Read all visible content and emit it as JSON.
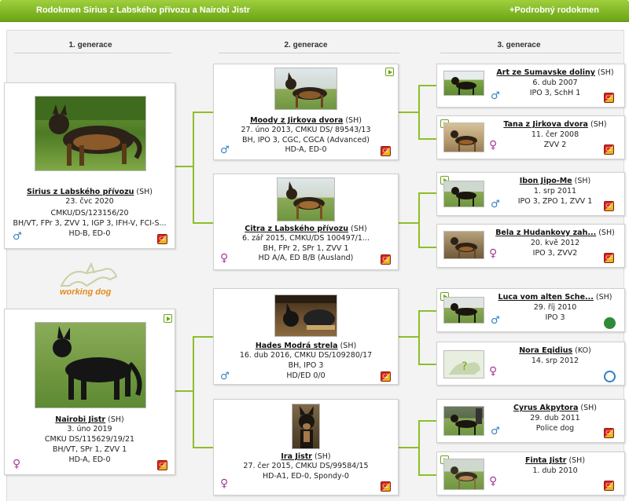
{
  "header": {
    "title": "Rodokmen Sirius z Labského přívozu a Nairobi Jistr",
    "more_link": "+Podrobný rodokmen"
  },
  "generations": [
    "1. generace",
    "2. generace",
    "3. generace"
  ],
  "logo": {
    "word1": "working",
    "word2": "dog"
  },
  "gen1": [
    {
      "name": "Sirius z Labského přívozu",
      "breed": "(SH)",
      "line1": "23. čvc 2020",
      "line2": "CMKU/DS/123156/20",
      "line3": "BH/VT, FPr 3, ZVV 1, IGP 3, IFH-V, FCI-S...",
      "line4": "HD-B, ED-0",
      "sex": "male"
    },
    {
      "name": "Nairobi Jistr",
      "breed": "(SH)",
      "line1": "3. úno 2019",
      "line2": "CMKU DS/115629/19/21",
      "line3": "BH/VT, SPr 1, ZVV 1",
      "line4": "HD-A, ED-0",
      "sex": "female"
    }
  ],
  "gen2": [
    {
      "name": "Moody z Jirkova dvora",
      "breed": "(SH)",
      "line1": "27. úno 2013, CMKU DS/ 89543/13",
      "line2": "BH, IPO 3, CGC, CGCA (Advanced)",
      "line3": "HD-A, ED-0",
      "sex": "male"
    },
    {
      "name": "Citra z Labského přívozu",
      "breed": "(SH)",
      "line1": "6. zář 2015, CMKU/DS 100497/1...",
      "line2": "BH, FPr 2, SPr 1, ZVV 1",
      "line3": "HD A/A, ED B/B (Ausland)",
      "sex": "female"
    },
    {
      "name": "Hades Modrá strela",
      "breed": "(SH)",
      "line1": "16. dub 2016, CMKU DS/109280/17",
      "line2": "BH, IPO 3",
      "line3": "HD/ED 0/0",
      "sex": "male"
    },
    {
      "name": "Ira Jistr",
      "breed": "(SH)",
      "line1": "27. čer 2015, CMKU DS/99584/15",
      "line2": "HD-A1, ED-0, Spondy-0",
      "line3": "",
      "sex": "female"
    }
  ],
  "gen3": [
    {
      "name": "Art ze Sumavske doliny",
      "breed": "(SH)",
      "line1": "6. dub 2007",
      "line2": "IPO 3, SchH 1",
      "sex": "male"
    },
    {
      "name": "Tana z Jirkova dvora",
      "breed": "(SH)",
      "line1": "11. čer 2008",
      "line2": "ZVV 2",
      "sex": "female"
    },
    {
      "name": "Ibon Jipo-Me",
      "breed": "(SH)",
      "line1": "1. srp 2011",
      "line2": "IPO 3, ZPO 1, ZVV 1",
      "sex": "male"
    },
    {
      "name": "Bela z Hudankovy zah...",
      "breed": "(SH)",
      "line1": "20. kvě 2012",
      "line2": "IPO 3, ZVV2",
      "sex": "female"
    },
    {
      "name": "Luca vom alten Sche...",
      "breed": "(SH)",
      "line1": "29. říj 2010",
      "line2": "IPO 3",
      "sex": "male"
    },
    {
      "name": "Nora Eqidius",
      "breed": "(KO)",
      "line1": "14. srp 2012",
      "line2": "",
      "sex": "female"
    },
    {
      "name": "Cyrus Akpytora",
      "breed": "(SH)",
      "line1": "29. dub 2011",
      "line2": "Police dog",
      "sex": "male"
    },
    {
      "name": "Finta Jistr",
      "breed": "(SH)",
      "line1": "1. dub 2010",
      "line2": "",
      "sex": "female"
    }
  ],
  "symbols": {
    "male": "♂",
    "female": "♀"
  },
  "flag_text": "CZ",
  "colors": {
    "accent": "#6aa516",
    "male": "#2f7fc4",
    "female": "#a53a9a",
    "link_line": "#8dbf2a"
  }
}
